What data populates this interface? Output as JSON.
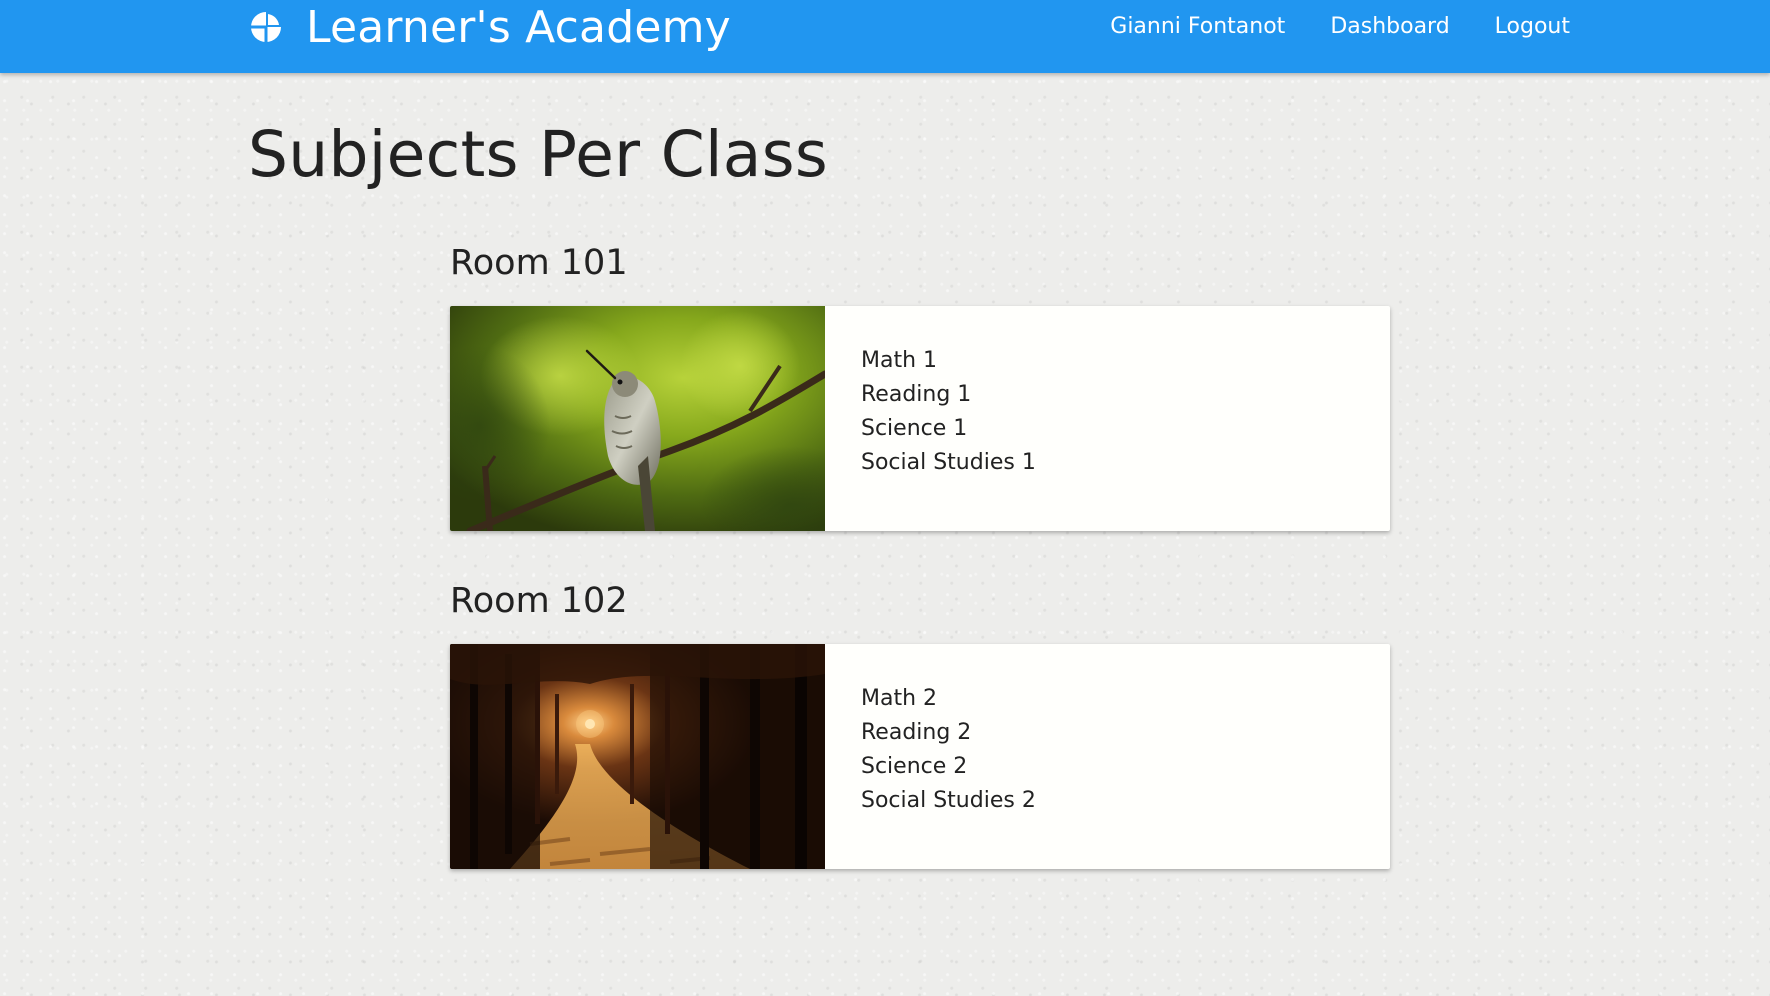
{
  "header": {
    "brand": "Learner's Academy",
    "logo_icon": "pie-chart-icon",
    "user_name": "Gianni Fontanot",
    "dashboard_label": "Dashboard",
    "logout_label": "Logout",
    "bar_color": "#2196f0"
  },
  "main": {
    "title": "Subjects Per Class",
    "rooms": [
      {
        "name": "Room 101",
        "image": "hummingbird-photo",
        "subjects": [
          "Math 1",
          "Reading 1",
          "Science 1",
          "Social Studies 1"
        ]
      },
      {
        "name": "Room 102",
        "image": "forest-path-photo",
        "subjects": [
          "Math 2",
          "Reading 2",
          "Science 2",
          "Social Studies 2"
        ]
      }
    ]
  }
}
